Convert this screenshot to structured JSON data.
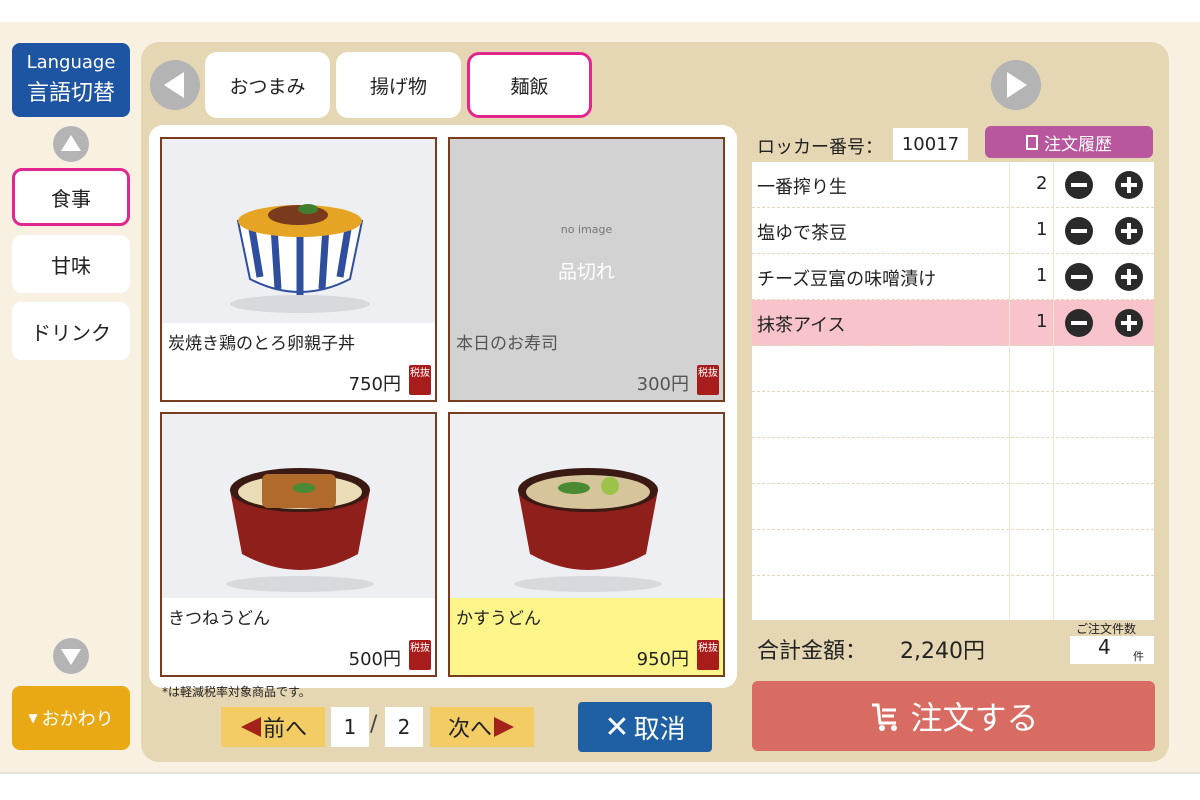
{
  "language_button": {
    "line1": "Language",
    "line2": "言語切替"
  },
  "categories": [
    {
      "label": "食事",
      "active": true
    },
    {
      "label": "甘味",
      "active": false
    },
    {
      "label": "ドリンク",
      "active": false
    }
  ],
  "refill_button": {
    "label": "おかわり"
  },
  "tabs": [
    {
      "label": "おつまみ",
      "active": false
    },
    {
      "label": "揚げ物",
      "active": false
    },
    {
      "label": "麺飯",
      "active": true
    }
  ],
  "menu_items": [
    {
      "name": "炭焼き鶏のとろ卵親子丼",
      "price": "750円",
      "tax_label": "税抜",
      "status": "available",
      "photo": "oyakodon-photo"
    },
    {
      "name": "本日のお寿司",
      "price": "300円",
      "tax_label": "税抜",
      "status": "sold_out",
      "no_image_text": "no image",
      "sold_out_text": "品切れ"
    },
    {
      "name": "きつねうどん",
      "price": "500円",
      "tax_label": "税抜",
      "status": "available",
      "photo": "kitsune-udon-photo"
    },
    {
      "name": "かすうどん",
      "price": "950円",
      "tax_label": "税抜",
      "status": "highlighted",
      "photo": "kasu-udon-photo"
    }
  ],
  "tax_note": "*は軽減税率対象商品です。",
  "pagination": {
    "prev_label": "前へ",
    "next_label": "次へ",
    "current": "1",
    "separator": "/",
    "total": "2"
  },
  "cancel_button": {
    "label": "取消"
  },
  "locker": {
    "label": "ロッカー番号：",
    "value": "10017"
  },
  "history_button": {
    "label": "注文履歴"
  },
  "order_items": [
    {
      "name": "一番搾り生",
      "qty": "2",
      "selected": false
    },
    {
      "name": "塩ゆで茶豆",
      "qty": "1",
      "selected": false
    },
    {
      "name": "チーズ豆富の味噌漬け",
      "qty": "1",
      "selected": false
    },
    {
      "name": "抹茶アイス",
      "qty": "1",
      "selected": true
    }
  ],
  "total": {
    "label": "合計金額：",
    "value": "2,240円"
  },
  "order_count": {
    "label": "ご注文件数",
    "value": "4",
    "unit": "件"
  },
  "order_button": {
    "label": "注文する"
  },
  "colors": {
    "accent_pink": "#e3268f",
    "panel_beige": "#e6d7b4",
    "language_blue": "#1e55a3",
    "order_red": "#d86b62",
    "tax_red": "#a81c1c"
  }
}
